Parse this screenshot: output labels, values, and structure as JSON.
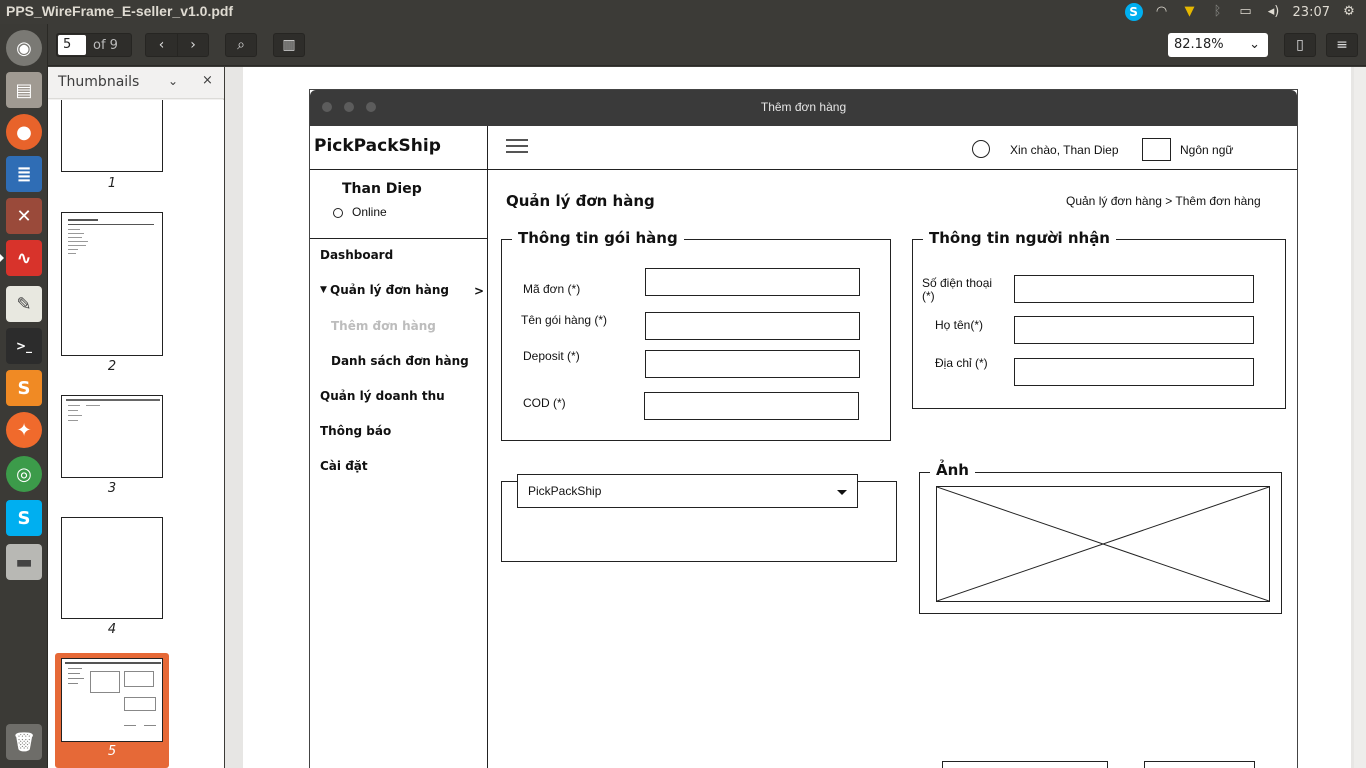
{
  "window": {
    "title": "PPS_WireFrame_E-seller_v1.0.pdf"
  },
  "tray": {
    "clock": "23:07"
  },
  "viewer": {
    "page_current": "5",
    "page_of": "of 9",
    "zoom": "82.18%"
  },
  "thumbnails": {
    "title": "Thumbnails",
    "pages": [
      "1",
      "2",
      "3",
      "4",
      "5"
    ]
  },
  "wireframe": {
    "window_title": "Thêm đơn hàng",
    "brand": "PickPackShip",
    "greeting": "Xin chào, Than Diep",
    "language": "Ngôn ngữ",
    "user_name": "Than Diep",
    "user_status": "Online",
    "menu": {
      "dashboard": "Dashboard",
      "orders": "Quản lý đơn hàng",
      "orders_arrow": ">",
      "add_order": "Thêm đơn hàng",
      "order_list": "Danh sách đơn hàng",
      "revenue": "Quản lý doanh thu",
      "notifications": "Thông báo",
      "settings": "Cài đặt"
    },
    "page_title": "Quản lý đơn hàng",
    "breadcrumb": "Quản lý đơn hàng > Thêm đơn hàng",
    "package": {
      "legend": "Thông tin gói hàng",
      "code": "Mã đơn (*)",
      "name": "Tên gói hàng (*)",
      "deposit": "Deposit (*)",
      "cod": "COD (*)"
    },
    "receiver": {
      "legend": "Thông tin người nhận",
      "phone": "Số điện thoại (*)",
      "fullname": "Họ tên(*)",
      "address": "Địa chỉ (*)"
    },
    "carrier": {
      "selected": "PickPackShip"
    },
    "image": {
      "legend": "Ảnh"
    }
  }
}
